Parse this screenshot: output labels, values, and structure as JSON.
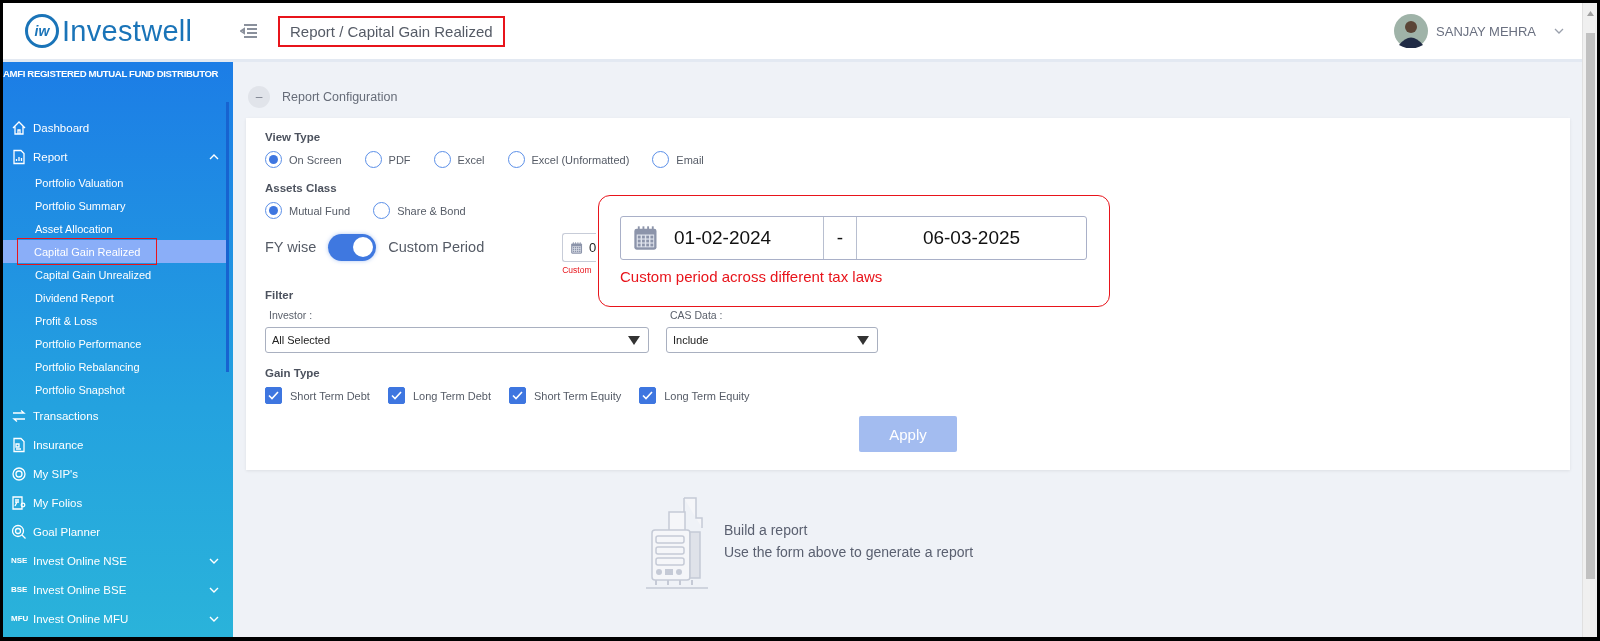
{
  "header": {
    "logo_mark": "iw",
    "logo": "Investwell",
    "breadcrumb": "Report / Capital Gain Realized",
    "breadcrumb_annotated": true,
    "user": "SANJAY MEHRA"
  },
  "sidebar": {
    "tagline": "AMFI REGISTERED MUTUAL FUND DISTRIBUTOR",
    "items": [
      {
        "kind": "home",
        "label": "Dashboard"
      },
      {
        "kind": "report",
        "label": "Report",
        "expanded": true,
        "children": [
          {
            "label": "Portfolio Valuation",
            "selected": false
          },
          {
            "label": "Portfolio Summary",
            "selected": false
          },
          {
            "label": "Asset Allocation",
            "selected": false
          },
          {
            "label": "Capital Gain Realized",
            "selected": true,
            "annotated": true
          },
          {
            "label": "Capital Gain Unrealized",
            "selected": false
          },
          {
            "label": "Dividend Report",
            "selected": false
          },
          {
            "label": "Profit & Loss",
            "selected": false
          },
          {
            "label": "Portfolio Performance",
            "selected": false
          },
          {
            "label": "Portfolio Rebalancing",
            "selected": false
          },
          {
            "label": "Portfolio Snapshot",
            "selected": false
          }
        ]
      },
      {
        "kind": "transfer",
        "label": "Transactions"
      },
      {
        "kind": "document",
        "label": "Insurance"
      },
      {
        "kind": "cycle",
        "label": "My SIP's"
      },
      {
        "kind": "folio",
        "label": "My Folios"
      },
      {
        "kind": "target",
        "label": "Goal Planner"
      },
      {
        "kind": "badge",
        "badge": "NSE",
        "label": "Invest Online NSE",
        "expanded": false
      },
      {
        "kind": "badge",
        "badge": "BSE",
        "label": "Invest Online BSE",
        "expanded": false
      },
      {
        "kind": "badge",
        "badge": "MFU",
        "label": "Invest Online MFU",
        "expanded": false
      }
    ]
  },
  "config": {
    "collapse_symbol": "–",
    "title": "Report Configuration",
    "view_type": {
      "label": "View Type",
      "options": [
        {
          "label": "On Screen",
          "selected": true
        },
        {
          "label": "PDF",
          "selected": false
        },
        {
          "label": "Excel",
          "selected": false
        },
        {
          "label": "Excel (Unformatted)",
          "selected": false
        },
        {
          "label": "Email",
          "selected": false
        }
      ]
    },
    "assets_class": {
      "label": "Assets Class",
      "options": [
        {
          "label": "Mutual Fund",
          "selected": true
        },
        {
          "label": "Share & Bond",
          "selected": false
        }
      ]
    },
    "period": {
      "left": "FY wise",
      "right": "Custom Period",
      "on": true,
      "field_value": "0",
      "field_note": "Custom"
    },
    "filter": {
      "label": "Filter",
      "investor": {
        "label": "Investor :",
        "value": "All Selected"
      },
      "cas": {
        "label": "CAS Data :",
        "value": "Include"
      }
    },
    "gain_type": {
      "label": "Gain Type",
      "options": [
        {
          "label": "Short Term Debt",
          "checked": true
        },
        {
          "label": "Long Term Debt",
          "checked": true
        },
        {
          "label": "Short Term Equity",
          "checked": true
        },
        {
          "label": "Long Term Equity",
          "checked": true
        }
      ]
    },
    "apply": {
      "label": "Apply",
      "disabled": true
    }
  },
  "callout": {
    "from": "01-02-2024",
    "separator": "-",
    "to": "06-03-2025",
    "warning": "Custom period across different tax laws"
  },
  "empty_state": {
    "title": "Build a report",
    "subtitle": "Use the form above to generate a report"
  }
}
